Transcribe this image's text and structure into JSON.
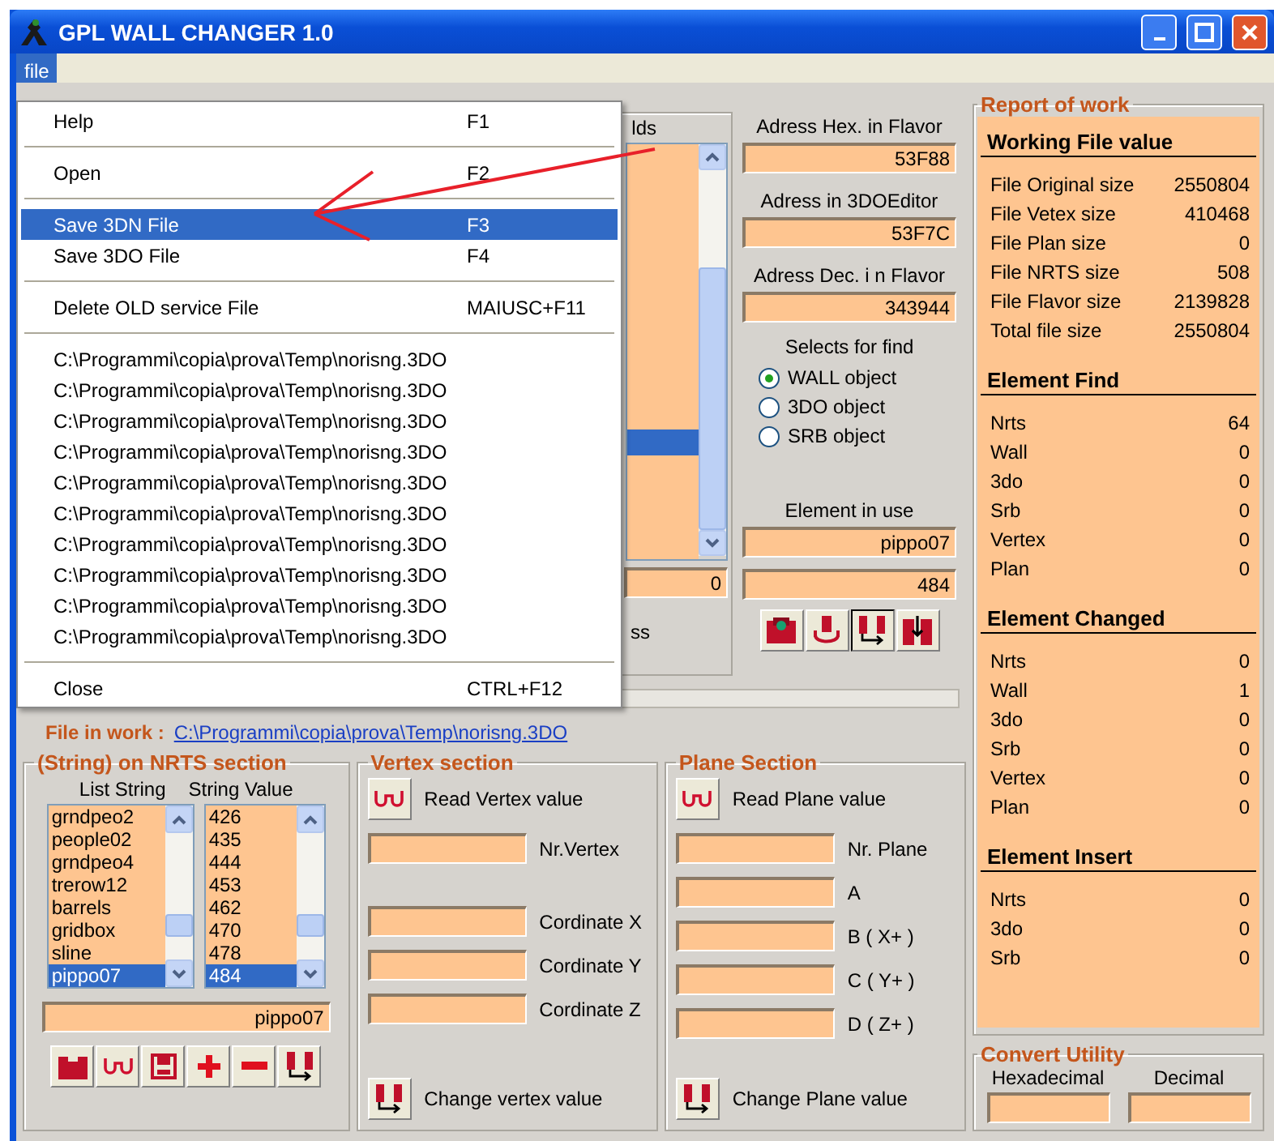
{
  "window": {
    "title": "GPL WALL CHANGER 1.0"
  },
  "menubar": [
    {
      "label": "file",
      "selected": true
    }
  ],
  "file_menu": {
    "groups": [
      [
        {
          "label": "Help",
          "shortcut": "F1",
          "selected": false
        }
      ],
      [
        {
          "label": "Open",
          "shortcut": "F2",
          "selected": false
        }
      ],
      [
        {
          "label": "Save 3DN File",
          "shortcut": "F3",
          "selected": true
        },
        {
          "label": "Save 3DO File",
          "shortcut": "F4",
          "selected": false
        }
      ],
      [
        {
          "label": "Delete OLD service File",
          "shortcut": "MAIUSC+F11",
          "selected": false
        }
      ],
      [
        {
          "label": "C:\\Programmi\\copia\\prova\\Temp\\norisng.3DO",
          "selected": false
        },
        {
          "label": "C:\\Programmi\\copia\\prova\\Temp\\norisng.3DO",
          "selected": false
        },
        {
          "label": "C:\\Programmi\\copia\\prova\\Temp\\norisng.3DO",
          "selected": false
        },
        {
          "label": "C:\\Programmi\\copia\\prova\\Temp\\norisng.3DO",
          "selected": false
        },
        {
          "label": "C:\\Programmi\\copia\\prova\\Temp\\norisng.3DO",
          "selected": false
        },
        {
          "label": "C:\\Programmi\\copia\\prova\\Temp\\norisng.3DO",
          "selected": false
        },
        {
          "label": "C:\\Programmi\\copia\\prova\\Temp\\norisng.3DO",
          "selected": false
        },
        {
          "label": "C:\\Programmi\\copia\\prova\\Temp\\norisng.3DO",
          "selected": false
        },
        {
          "label": "C:\\Programmi\\copia\\prova\\Temp\\norisng.3DO",
          "selected": false
        },
        {
          "label": "C:\\Programmi\\copia\\prova\\Temp\\norisng.3DO",
          "selected": false
        }
      ],
      [
        {
          "label": "Close",
          "shortcut": "CTRL+F12",
          "selected": false
        }
      ]
    ]
  },
  "fields_group": {
    "heading": "lds",
    "list_rows": [
      {
        "selected": true
      }
    ],
    "counter": "0",
    "caption": "ss"
  },
  "address": [
    {
      "label": "Adress Hex. in Flavor",
      "value": "53F88"
    },
    {
      "label": "Adress in 3DOEditor",
      "value": "53F7C"
    },
    {
      "label": "Adress Dec. i n Flavor",
      "value": "343944"
    }
  ],
  "find": {
    "label": "Selects for find",
    "options": [
      {
        "label": "WALL object",
        "selected": true
      },
      {
        "label": "3DO object",
        "selected": false
      },
      {
        "label": "SRB object",
        "selected": false
      }
    ]
  },
  "element_in_use": {
    "label": "Element in use",
    "name": "pippo07",
    "value": "484"
  },
  "tools": [
    {
      "kind": "picture",
      "selected": false
    },
    {
      "kind": "figure",
      "selected": false
    },
    {
      "kind": "swap",
      "selected": true
    },
    {
      "kind": "insert",
      "selected": false
    }
  ],
  "file_in_work": {
    "label": "File in work :",
    "path": "C:\\Programmi\\copia\\prova\\Temp\\norisng.3DO"
  },
  "nrts": {
    "title": "(String)  on NRTS section",
    "columns": [
      "List String",
      "String Value"
    ],
    "rows": [
      {
        "name": "grndpeo2",
        "value": "426",
        "selected": false
      },
      {
        "name": "people02",
        "value": "435",
        "selected": false
      },
      {
        "name": "grndpeo4",
        "value": "444",
        "selected": false
      },
      {
        "name": "trerow12",
        "value": "453",
        "selected": false
      },
      {
        "name": "barrels",
        "value": "462",
        "selected": false
      },
      {
        "name": "gridbox",
        "value": "470",
        "selected": false
      },
      {
        "name": "sline",
        "value": "478",
        "selected": false
      },
      {
        "name": "pippo07",
        "value": "484",
        "selected": true
      }
    ],
    "current": "pippo07",
    "tools": [
      {
        "kind": "block"
      },
      {
        "kind": "glasses"
      },
      {
        "kind": "floppy"
      },
      {
        "kind": "plus"
      },
      {
        "kind": "minus"
      },
      {
        "kind": "swap"
      }
    ]
  },
  "vertex": {
    "title": "Vertex section",
    "read": "Read Vertex value",
    "fields": [
      {
        "label": "Nr.Vertex",
        "kind": "index"
      },
      {
        "label": "Cordinate X",
        "kind": "coordinate"
      },
      {
        "label": "Cordinate Y",
        "kind": "coordinate"
      },
      {
        "label": "Cordinate Z",
        "kind": "coordinate"
      }
    ],
    "change": "Change vertex value"
  },
  "plane": {
    "title": "Plane Section",
    "read": "Read Plane value",
    "fields": [
      {
        "label": "Nr. Plane"
      },
      {
        "label": "A"
      },
      {
        "label": "B  ( X+ )"
      },
      {
        "label": "C  ( Y+ )"
      },
      {
        "label": "D  ( Z+ )"
      }
    ],
    "change": "Change Plane value"
  },
  "report": {
    "title": "Report of work",
    "sections": [
      {
        "title": "Working File value",
        "rows": [
          {
            "label": "File Original size",
            "value": "2550804"
          },
          {
            "label": "File Vetex size",
            "value": "410468"
          },
          {
            "label": "File Plan size",
            "value": "0"
          },
          {
            "label": "File NRTS size",
            "value": "508"
          },
          {
            "label": "File Flavor size",
            "value": "2139828"
          },
          {
            "label": "Total file size",
            "value": "2550804"
          }
        ]
      },
      {
        "title": "Element Find",
        "rows": [
          {
            "label": "Nrts",
            "value": "64"
          },
          {
            "label": "Wall",
            "value": "0"
          },
          {
            "label": "3do",
            "value": "0"
          },
          {
            "label": "Srb",
            "value": "0"
          },
          {
            "label": "Vertex",
            "value": "0"
          },
          {
            "label": "Plan",
            "value": "0"
          }
        ]
      },
      {
        "title": "Element Changed",
        "rows": [
          {
            "label": "Nrts",
            "value": "0"
          },
          {
            "label": "Wall",
            "value": "1"
          },
          {
            "label": "3do",
            "value": "0"
          },
          {
            "label": "Srb",
            "value": "0"
          },
          {
            "label": "Vertex",
            "value": "0"
          },
          {
            "label": "Plan",
            "value": "0"
          }
        ]
      },
      {
        "title": "Element Insert",
        "rows": [
          {
            "label": "Nrts",
            "value": "0"
          },
          {
            "label": "3do",
            "value": "0"
          },
          {
            "label": "Srb",
            "value": "0"
          }
        ]
      }
    ]
  },
  "convert": {
    "title": "Convert Utility",
    "fields": [
      {
        "label": "Hexadecimal"
      },
      {
        "label": "Decimal"
      }
    ]
  }
}
